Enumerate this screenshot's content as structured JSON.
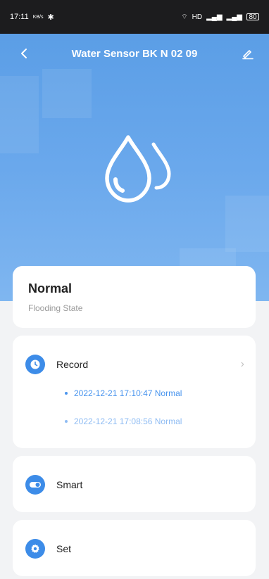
{
  "status_bar": {
    "time": "17:11",
    "left_extra": "KB/s",
    "right_indicators": "HD",
    "battery": "80"
  },
  "header": {
    "title": "Water Sensor BK N 02 09"
  },
  "state": {
    "value": "Normal",
    "label": "Flooding State"
  },
  "record": {
    "label": "Record",
    "entries": [
      "2022-12-21 17:10:47 Normal",
      "2022-12-21 17:08:56 Normal"
    ]
  },
  "smart": {
    "label": "Smart"
  },
  "settings": {
    "label": "Set"
  },
  "colors": {
    "accent": "#3d8ce8",
    "hero_top": "#5b9ee6",
    "hero_bottom": "#7fb6f0",
    "record_text": "#4a95ee"
  }
}
